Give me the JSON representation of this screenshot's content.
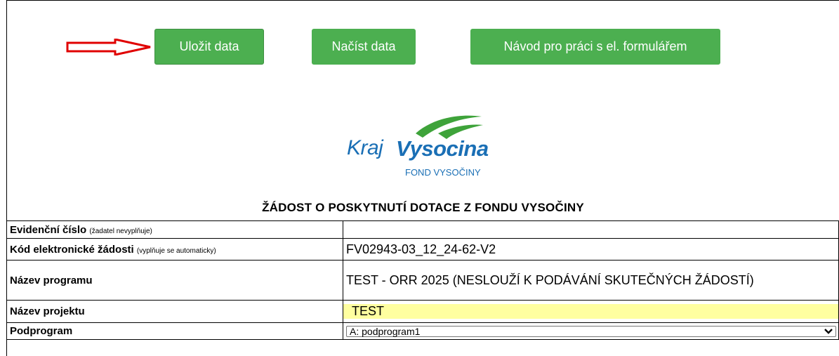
{
  "toolbar": {
    "save_label": "Uložit data",
    "load_label": "Načíst data",
    "guide_label": "Návod pro práci s el. formulářem"
  },
  "logo": {
    "kraj": "Kraj",
    "vysocina": "Vysocina",
    "fond": "FOND VYSOČINY"
  },
  "form_title": "ŽÁDOST O POSKYTNUTÍ DOTACE Z FONDU VYSOČINY",
  "rows": {
    "evidencni": {
      "label": "Evidenční číslo",
      "note": "(žadatel nevyplňuje)",
      "value": ""
    },
    "kod": {
      "label": "Kód elektronické žádosti",
      "note": "(vyplňuje se automaticky)",
      "value": "FV02943-03_12_24-62-V2"
    },
    "program": {
      "label": "Název programu",
      "value": "TEST - ORR 2025 (NESLOUŽÍ K PODÁVÁNÍ SKUTEČNÝCH ŽÁDOSTÍ)"
    },
    "projekt": {
      "label": "Název projektu",
      "value": "TEST"
    },
    "podprogram": {
      "label": "Podprogram",
      "selected": "A: podprogram1"
    }
  },
  "colors": {
    "button_green": "#4caf50",
    "arrow_red": "#e00000",
    "logo_blue": "#1a6fb5",
    "logo_green": "#3ea33a",
    "input_yellow": "#ffffa0"
  },
  "icons": [
    "arrow-right-icon",
    "logo-swoosh-icon",
    "chevron-down-icon"
  ]
}
